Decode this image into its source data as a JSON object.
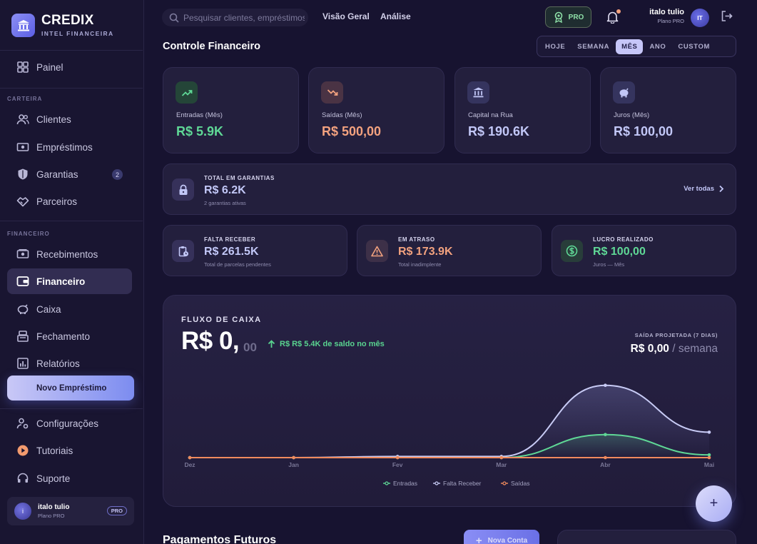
{
  "brand": {
    "name": "CREDIX",
    "subtitle": "INTEL FINANCEIRA"
  },
  "sidebar": {
    "painel": "Painel",
    "section_carteira": "CARTEIRA",
    "clientes": "Clientes",
    "emprestimos": "Empréstimos",
    "garantias": "Garantias",
    "garantias_badge": "2",
    "parceiros": "Parceiros",
    "section_financeiro": "FINANCEIRO",
    "recebimentos": "Recebimentos",
    "financeiro": "Financeiro",
    "caixa": "Caixa",
    "fechamento": "Fechamento",
    "relatorios": "Relatórios",
    "novo_emprestimo": "Novo Empréstimo",
    "configuracoes": "Configurações",
    "tutoriais": "Tutoriais",
    "suporte": "Suporte",
    "user": {
      "initial": "i",
      "name": "italo tulio",
      "plan": "Plano PRO",
      "badge": "PRO"
    }
  },
  "topbar": {
    "search_placeholder": "Pesquisar clientes, empréstimos",
    "link_overview": "Visão Geral",
    "link_analysis": "Análise",
    "pro_label": "PRO",
    "user": {
      "name": "italo tulio",
      "plan": "Plano PRO",
      "initials": "IT"
    }
  },
  "page": {
    "title": "Controle Financeiro",
    "periods": [
      "HOJE",
      "SEMANA",
      "MÊS",
      "ANO",
      "CUSTOM"
    ],
    "active_period": "MÊS"
  },
  "kpis": [
    {
      "label": "Entradas (Mês)",
      "value": "R$ 5.9K",
      "color": "#5fd896",
      "icon": "trending-up-icon"
    },
    {
      "label": "Saídas (Mês)",
      "value": "R$ 500,00",
      "color": "#f3a27f",
      "icon": "trending-down-icon"
    },
    {
      "label": "Capital na Rua",
      "value": "R$ 190.6K",
      "color": "#c2c7f7",
      "icon": "bank-icon"
    },
    {
      "label": "Juros (Mês)",
      "value": "R$ 100,00",
      "color": "#c2c7f7",
      "icon": "piggy-bank-icon"
    }
  ],
  "guarantees": {
    "label": "TOTAL EM GARANTIAS",
    "value": "R$ 6.2K",
    "sub": "2 garantias ativas",
    "link": "Ver todas"
  },
  "stats": [
    {
      "label": "FALTA RECEBER",
      "value": "R$ 261.5K",
      "sub": "Total de parcelas pendentes",
      "color": "#c2c7f7",
      "icon": "clipboard-clock-icon"
    },
    {
      "label": "EM ATRASO",
      "value": "R$ 173.9K",
      "sub": "Total inadimplente",
      "color": "#f3a27f",
      "icon": "warning-icon"
    },
    {
      "label": "LUCRO REALIZADO",
      "value": "R$ 100,00",
      "sub": "Juros — Mês",
      "color": "#5fd896",
      "icon": "dollar-circle-icon"
    }
  ],
  "cashflow": {
    "label": "FLUXO DE CAIXA",
    "value_main": "R$ 0,",
    "value_cents": "00",
    "delta": "R$ R$ 5.4K de saldo no mês",
    "projection_label": "SAÍDA PROJETADA (7 DIAS)",
    "projection_value": "R$ 0,00",
    "projection_unit": " / semana"
  },
  "chart_data": {
    "type": "line",
    "x": [
      "Dez",
      "Jan",
      "Fev",
      "Mar",
      "Abr",
      "Mai"
    ],
    "series": [
      {
        "name": "Entradas",
        "color": "#5fd896",
        "values": [
          0,
          0,
          0,
          0,
          5.9,
          0.7
        ]
      },
      {
        "name": "Falta Receber",
        "color": "#c8cbf5",
        "values": [
          0,
          0,
          0.3,
          0.3,
          18.5,
          6.5
        ]
      },
      {
        "name": "Saídas",
        "color": "#f08a5d",
        "values": [
          0,
          0,
          0,
          0,
          0,
          0
        ]
      }
    ],
    "legend_position": "bottom-center",
    "grid": false,
    "axis": {
      "y_visible": false,
      "ylim": [
        0,
        19
      ]
    }
  },
  "fab": {
    "label": "+"
  },
  "future": {
    "title": "Pagamentos Futuros",
    "new_account": "Nova Conta",
    "plus": "+"
  }
}
